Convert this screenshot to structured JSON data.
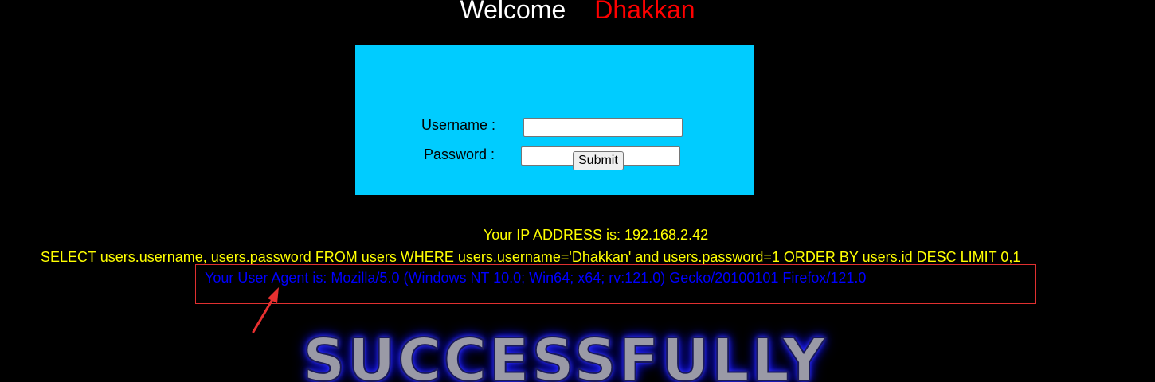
{
  "header": {
    "welcome_word": "Welcome",
    "user_name": "Dhakkan"
  },
  "login_form": {
    "username_label": "Username :",
    "username_value": "",
    "password_label": "Password :",
    "password_value": "",
    "submit_label": "Submit",
    "background_color": "#00ccff"
  },
  "output": {
    "ip_line": "Your IP ADDRESS is: 192.168.2.42",
    "sql_line": "SELECT users.username, users.password FROM users WHERE users.username='Dhakkan' and users.password=1 ORDER BY users.id DESC LIMIT 0,1",
    "user_agent_line": "Your User Agent is: Mozilla/5.0 (Windows NT 10.0; Win64; x64; rv:121.0) Gecko/20100101 Firefox/121.0"
  },
  "banner": {
    "text": "SUCCESSFULLY"
  },
  "annotations": {
    "highlight_color": "#e03030"
  }
}
